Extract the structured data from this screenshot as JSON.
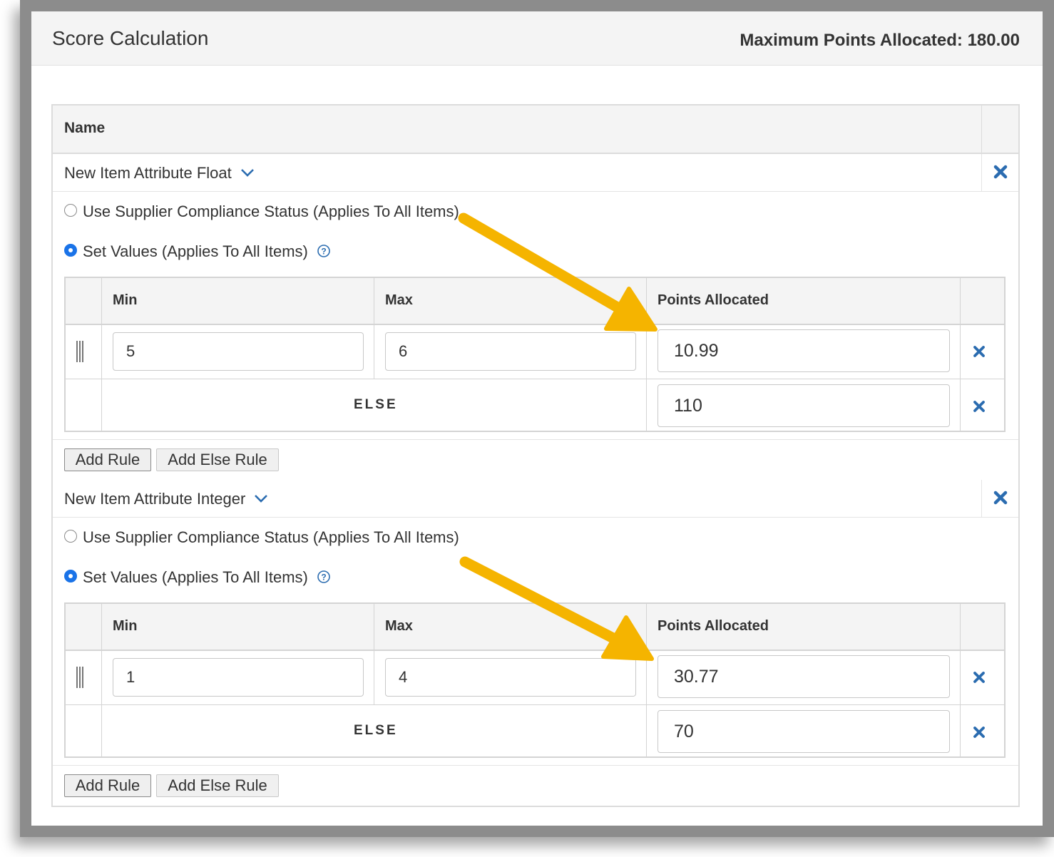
{
  "panel": {
    "title": "Score Calculation",
    "max_points": "Maximum Points Allocated: 180.00"
  },
  "table": {
    "name_header": "Name"
  },
  "sections": [
    {
      "title": "New Item Attribute Float",
      "radio_compliance": "Use Supplier Compliance Status (Applies To All Items)",
      "radio_set_values": "Set Values (Applies To All Items)",
      "selected_option": "Set Values (Applies To All Items)",
      "columns": {
        "min": "Min",
        "max": "Max",
        "points": "Points Allocated"
      },
      "rule": {
        "min": "5",
        "max": "6",
        "points": "10.99"
      },
      "else_label": "ELSE",
      "else_points": "110",
      "add_rule": "Add Rule",
      "add_else_rule": "Add Else Rule"
    },
    {
      "title": "New Item Attribute Integer",
      "radio_compliance": "Use Supplier Compliance Status (Applies To All Items)",
      "radio_set_values": "Set Values (Applies To All Items)",
      "selected_option": "Set Values (Applies To All Items)",
      "columns": {
        "min": "Min",
        "max": "Max",
        "points": "Points Allocated"
      },
      "rule": {
        "min": "1",
        "max": "4",
        "points": "30.77"
      },
      "else_label": "ELSE",
      "else_points": "70",
      "add_rule": "Add Rule",
      "add_else_rule": "Add Else Rule"
    }
  ],
  "colors": {
    "accent_blue": "#2b6cb0",
    "radio_blue": "#1a73e8",
    "arrow_yellow": "#f5b400",
    "frame_gray": "#8c8c8c"
  },
  "icons": [
    "chevron-down-icon",
    "close-icon",
    "help-icon",
    "drag-handle-icon",
    "arrow-annotation"
  ]
}
